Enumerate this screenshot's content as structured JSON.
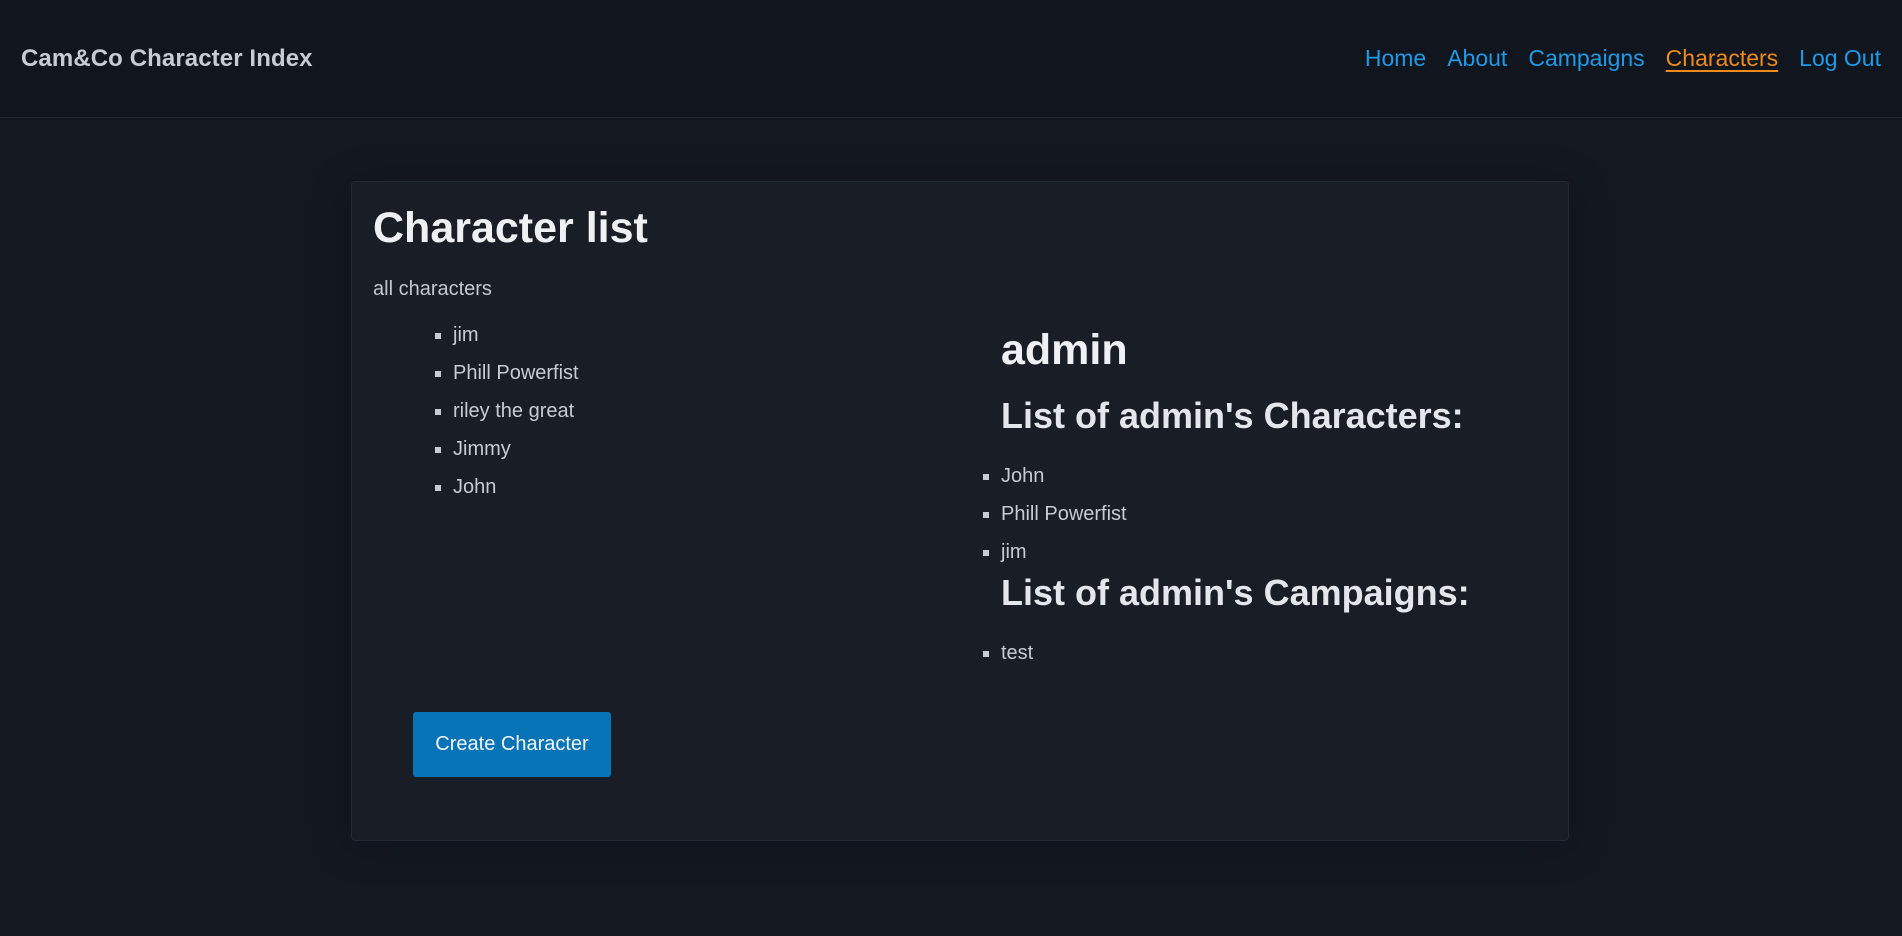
{
  "navbar": {
    "brand": "Cam&Co Character Index",
    "links": [
      {
        "label": "Home",
        "active": false
      },
      {
        "label": "About",
        "active": false
      },
      {
        "label": "Campaigns",
        "active": false
      },
      {
        "label": "Characters",
        "active": true
      },
      {
        "label": "Log Out",
        "active": false
      }
    ],
    "link_color": "#1e9ae8",
    "active_color": "#f08a1c"
  },
  "main": {
    "title": "Character list",
    "subtitle": "all characters",
    "characters": [
      "jim",
      "Phill Powerfist",
      "riley the great",
      "Jimmy",
      "John"
    ],
    "create_button_label": "Create Character"
  },
  "profile": {
    "username": "admin",
    "characters_heading": "List of admin's Characters:",
    "characters": [
      "John",
      "Phill Powerfist",
      "jim"
    ],
    "campaigns_heading": "List of admin's Campaigns:",
    "campaigns": [
      "test"
    ]
  },
  "colors": {
    "background": "#141821",
    "card": "#191d26",
    "button": "#0874b8"
  }
}
